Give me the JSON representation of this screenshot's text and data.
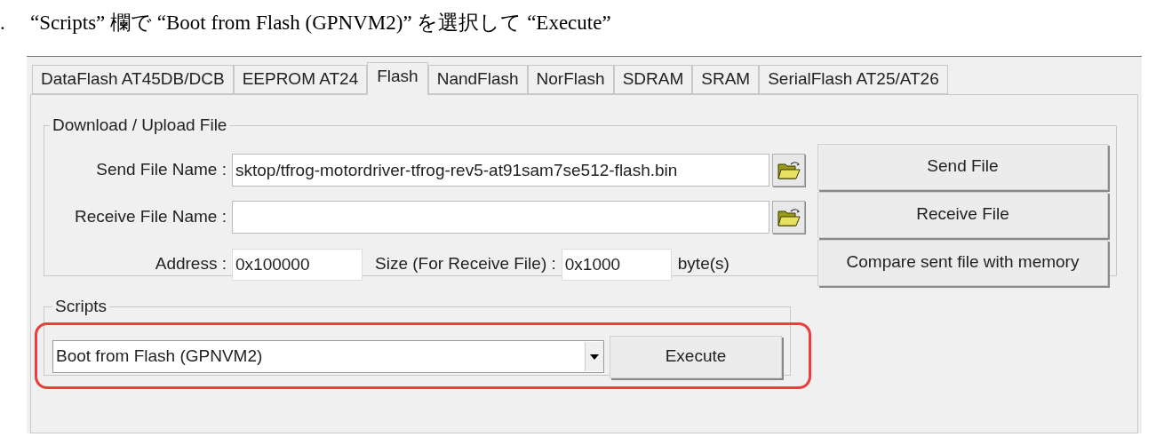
{
  "caption": {
    "number": ".",
    "text": "“Scripts” 欄で “Boot from Flash (GPNVM2)” を選択して “Execute”"
  },
  "tabs": [
    {
      "label": "DataFlash AT45DB/DCB",
      "selected": false
    },
    {
      "label": "EEPROM AT24",
      "selected": false
    },
    {
      "label": "Flash",
      "selected": true
    },
    {
      "label": "NandFlash",
      "selected": false
    },
    {
      "label": "NorFlash",
      "selected": false
    },
    {
      "label": "SDRAM",
      "selected": false
    },
    {
      "label": "SRAM",
      "selected": false
    },
    {
      "label": "SerialFlash AT25/AT26",
      "selected": false
    }
  ],
  "download_group": {
    "title": "Download / Upload File",
    "send_file_name": {
      "label": "Send File Name :",
      "value": "sktop/tfrog-motordriver-tfrog-rev5-at91sam7se512-flash.bin"
    },
    "receive_file_name": {
      "label": "Receive File Name :"
    },
    "address": {
      "label": "Address :",
      "value": "0x100000"
    },
    "size": {
      "label": "Size (For Receive File) :",
      "value": "0x1000",
      "unit": "byte(s)"
    },
    "buttons": [
      "Send File",
      "Receive File",
      "Compare sent file with memory"
    ]
  },
  "scripts_group": {
    "title": "Scripts",
    "selected_script": "Boot from Flash (GPNVM2)",
    "execute_button": "Execute",
    "highlighted": true
  }
}
